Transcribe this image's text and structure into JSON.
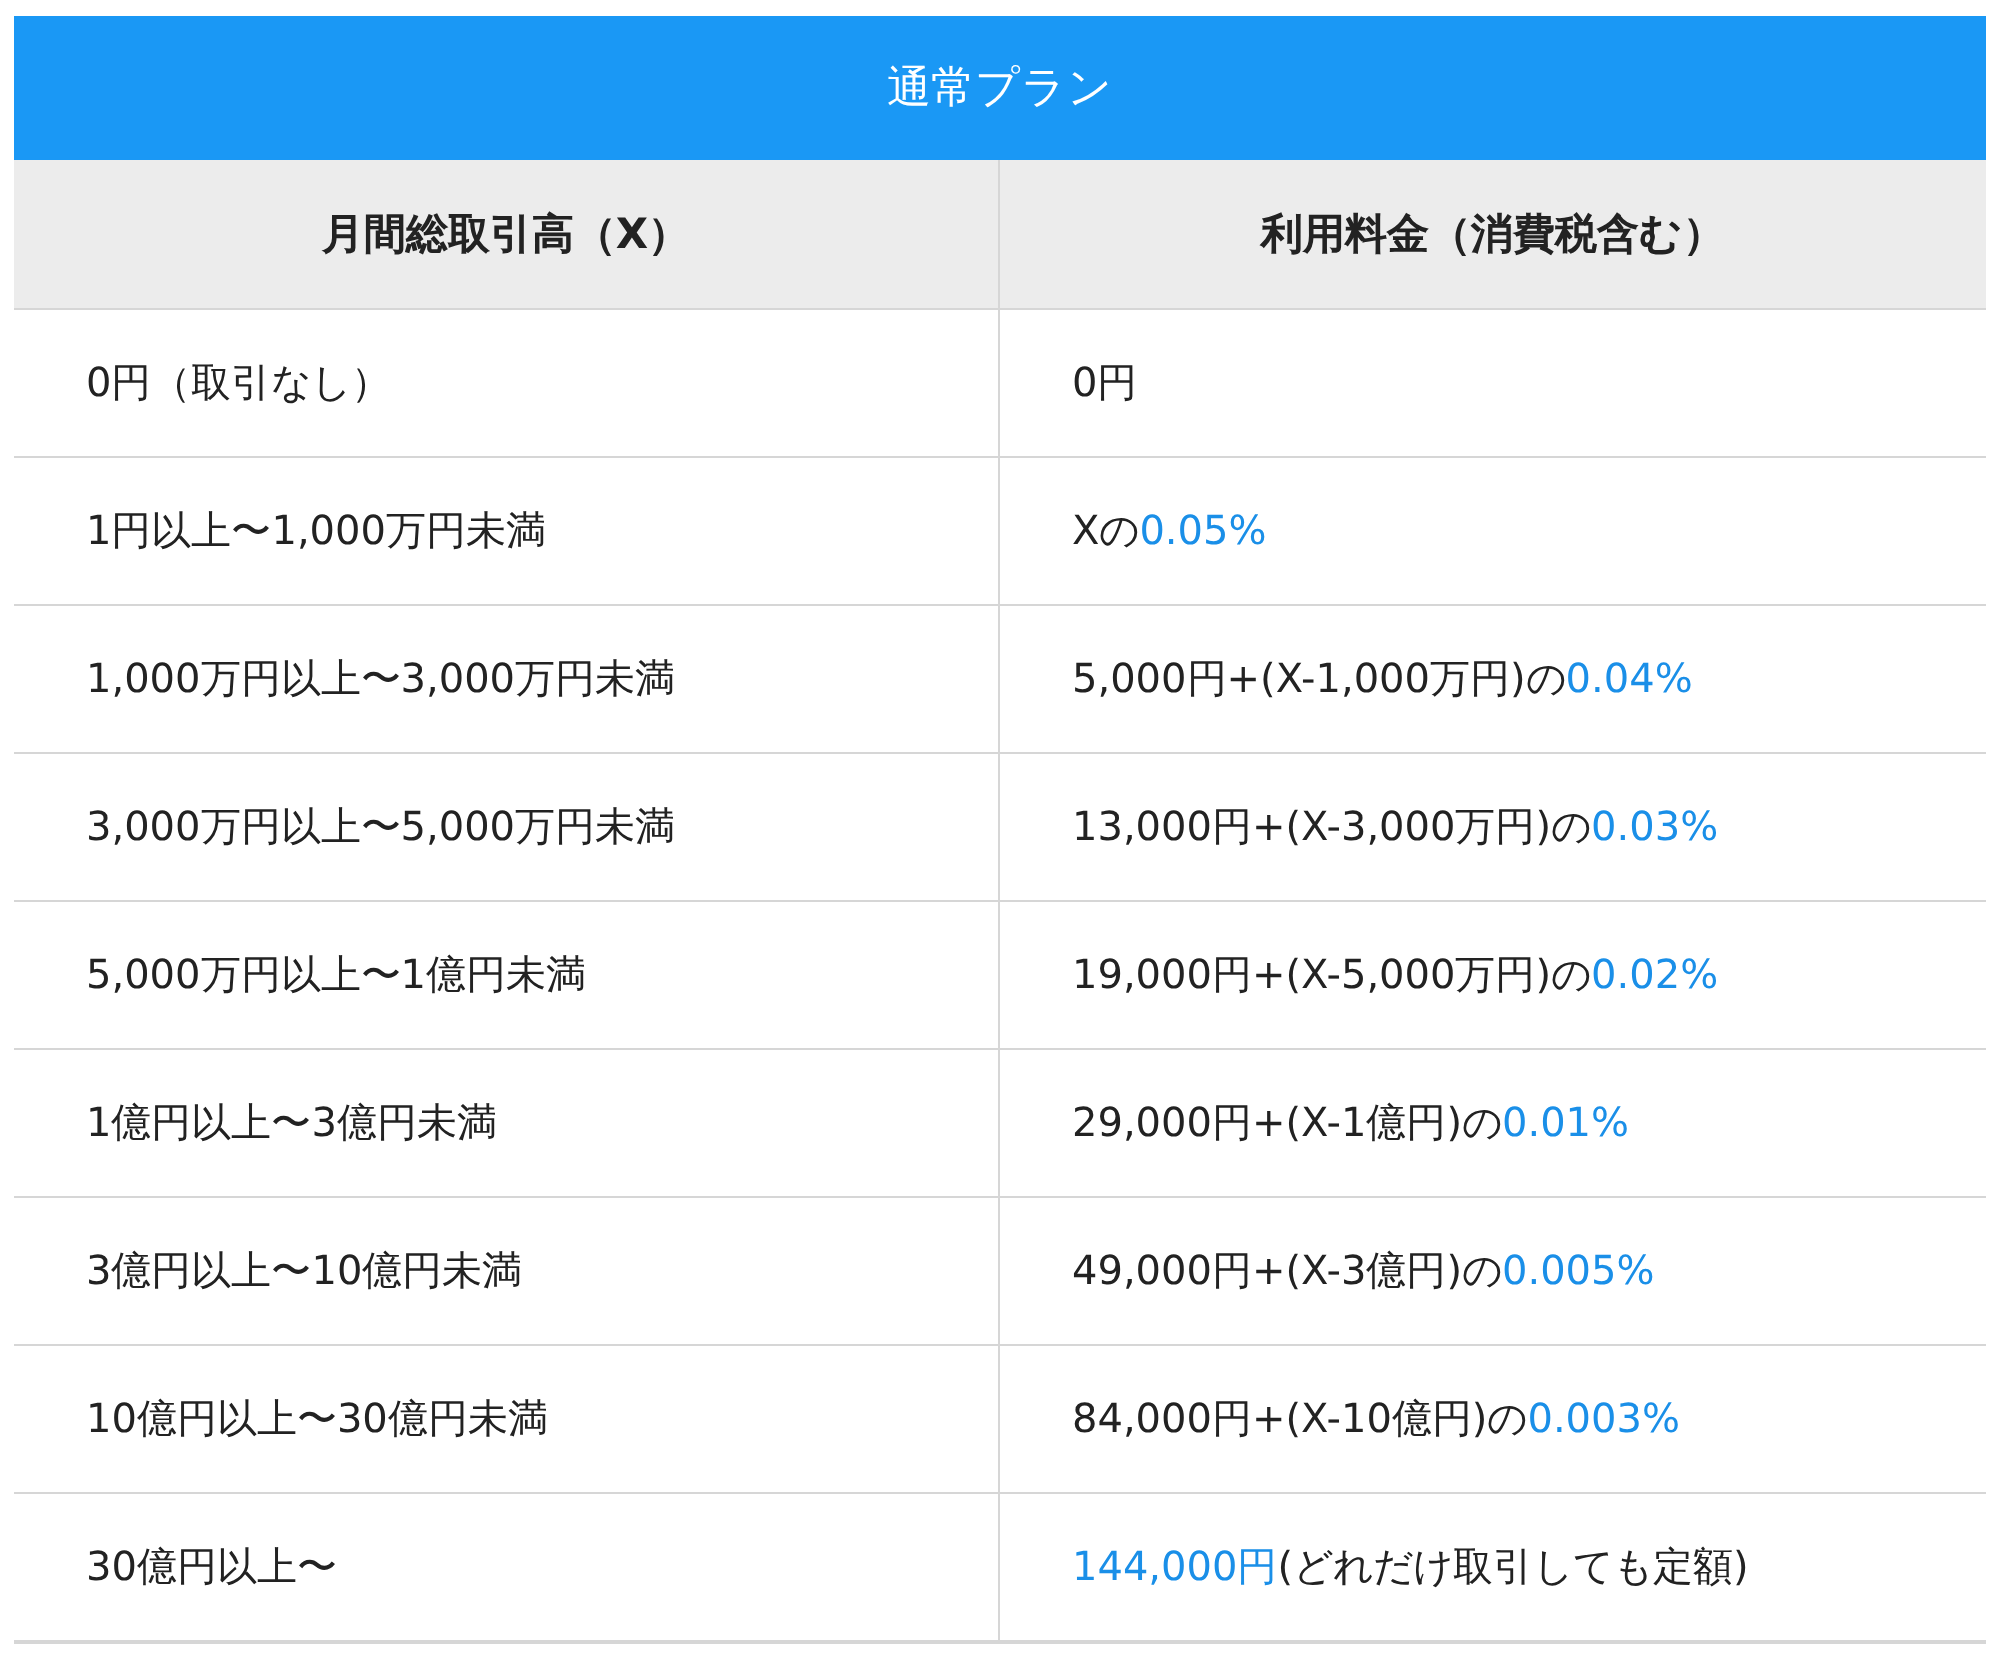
{
  "title": "通常プラン",
  "columns": [
    "月間総取引高（X）",
    "利用料金（消費税含む）"
  ],
  "rows": [
    {
      "volume": "0円（取引なし）",
      "fee": [
        {
          "text": "0円",
          "accent": false
        }
      ]
    },
    {
      "volume": "1円以上〜1,000万円未満",
      "fee": [
        {
          "text": "Xの",
          "accent": false
        },
        {
          "text": "0.05%",
          "accent": true
        }
      ]
    },
    {
      "volume": "1,000万円以上〜3,000万円未満",
      "fee": [
        {
          "text": "5,000円+(X-1,000万円)の",
          "accent": false
        },
        {
          "text": "0.04%",
          "accent": true
        }
      ]
    },
    {
      "volume": "3,000万円以上〜5,000万円未満",
      "fee": [
        {
          "text": "13,000円+(X-3,000万円)の",
          "accent": false
        },
        {
          "text": "0.03%",
          "accent": true
        }
      ]
    },
    {
      "volume": "5,000万円以上〜1億円未満",
      "fee": [
        {
          "text": "19,000円+(X-5,000万円)の",
          "accent": false
        },
        {
          "text": "0.02%",
          "accent": true
        }
      ]
    },
    {
      "volume": "1億円以上〜3億円未満",
      "fee": [
        {
          "text": "29,000円+(X-1億円)の",
          "accent": false
        },
        {
          "text": "0.01%",
          "accent": true
        }
      ]
    },
    {
      "volume": "3億円以上〜10億円未満",
      "fee": [
        {
          "text": "49,000円+(X-3億円)の",
          "accent": false
        },
        {
          "text": "0.005%",
          "accent": true
        }
      ]
    },
    {
      "volume": "10億円以上〜30億円未満",
      "fee": [
        {
          "text": "84,000円+(X-10億円)の",
          "accent": false
        },
        {
          "text": "0.003%",
          "accent": true
        }
      ]
    },
    {
      "volume": "30億円以上〜",
      "fee": [
        {
          "text": "144,000円",
          "accent": true
        },
        {
          "text": "(どれだけ取引しても定額)",
          "accent": false
        }
      ]
    }
  ]
}
